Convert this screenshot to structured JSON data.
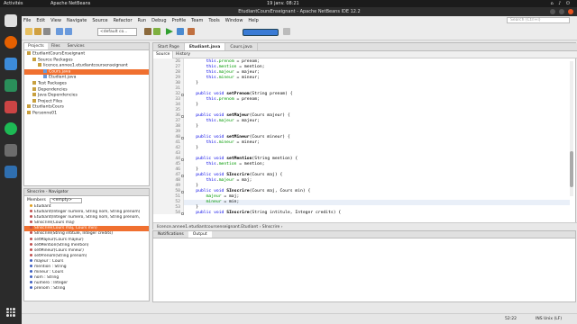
{
  "system": {
    "activities": "Activités",
    "app_name": "Apache NetBeans",
    "clock": "19 janv. 08:21"
  },
  "window": {
    "title": "EtudiantCoursEnseignant - Apache NetBeans IDE 12.2"
  },
  "menu": [
    "File",
    "Edit",
    "View",
    "Navigate",
    "Source",
    "Refactor",
    "Run",
    "Debug",
    "Profile",
    "Team",
    "Tools",
    "Window",
    "Help"
  ],
  "search_placeholder": "Search (Ctrl+I)",
  "toolbar": {
    "config": "<default co...",
    "icons": [
      "new-file-icon",
      "open-project-icon",
      "save-icon",
      "undo-icon",
      "redo-icon",
      "build-icon",
      "run-icon",
      "debug-icon",
      "profile-icon"
    ]
  },
  "projects": {
    "tabs": [
      "Projects",
      "Files",
      "Services"
    ],
    "nodes": [
      {
        "label": "EtudiantCoursEnseignant",
        "depth": 0
      },
      {
        "label": "Source Packages",
        "depth": 1
      },
      {
        "label": "licence.annee1.etudiantcoursenseignant",
        "depth": 2
      },
      {
        "label": "Cours.java",
        "depth": 3,
        "selected": true
      },
      {
        "label": "Etudiant.java",
        "depth": 3
      },
      {
        "label": "Test Packages",
        "depth": 1
      },
      {
        "label": "Dependencies",
        "depth": 1
      },
      {
        "label": "Java Dependencies",
        "depth": 1
      },
      {
        "label": "Project Files",
        "depth": 1
      },
      {
        "label": "EtudiantsCours",
        "depth": 0
      },
      {
        "label": "Personne01",
        "depth": 0
      }
    ]
  },
  "navigator": {
    "title": "SInscrire - Navigator",
    "filter_label": "Members",
    "filter_value": "<empty>",
    "items": [
      {
        "label": "Etudiant",
        "kind": "class"
      },
      {
        "label": "Etudiant(Integer numero, String nom, String prenom)",
        "kind": "m"
      },
      {
        "label": "Etudiant(Integer numero, String nom, String prenom,",
        "kind": "m"
      },
      {
        "label": "SInscrire(Cours maj)",
        "kind": "m"
      },
      {
        "label": "SInscrire(Cours maj, Cours min)",
        "kind": "m",
        "selected": true
      },
      {
        "label": "SInscrire(String intitule, Integer credits)",
        "kind": "m"
      },
      {
        "label": "setMajeur(Cours majeur)",
        "kind": "m"
      },
      {
        "label": "setMention(String mention)",
        "kind": "m"
      },
      {
        "label": "setMineur(Cours mineur)",
        "kind": "m"
      },
      {
        "label": "setPrenom(String prenom)",
        "kind": "m"
      },
      {
        "label": "majeur : Cours",
        "kind": "f"
      },
      {
        "label": "mention : String",
        "kind": "f"
      },
      {
        "label": "mineur : Cours",
        "kind": "f"
      },
      {
        "label": "nom : String",
        "kind": "f"
      },
      {
        "label": "numero : Integer",
        "kind": "f"
      },
      {
        "label": "prenom : String",
        "kind": "f"
      }
    ]
  },
  "editor": {
    "tabs": [
      "Start Page",
      "Etudiant.java",
      "Cours.java"
    ],
    "active_tab": 1,
    "source_tabs": [
      "Source",
      "History"
    ],
    "lines": [
      {
        "n": "26",
        "text": "        this.prenom = prenom;"
      },
      {
        "n": "27",
        "text": "        this.mention = mention;"
      },
      {
        "n": "28",
        "text": "        this.majeur = majeur;"
      },
      {
        "n": "29",
        "text": "        this.mineur = mineur;"
      },
      {
        "n": "30",
        "text": "    }"
      },
      {
        "n": "31",
        "text": ""
      },
      {
        "n": "32",
        "text": "    public void setPrenom(String prenom) {",
        "fold": true
      },
      {
        "n": "33",
        "text": "        this.prenom = prenom;"
      },
      {
        "n": "34",
        "text": "    }"
      },
      {
        "n": "35",
        "text": ""
      },
      {
        "n": "36",
        "text": "    public void setMajeur(Cours majeur) {",
        "fold": true
      },
      {
        "n": "37",
        "text": "        this.majeur = majeur;"
      },
      {
        "n": "38",
        "text": "    }"
      },
      {
        "n": "39",
        "text": ""
      },
      {
        "n": "40",
        "text": "    public void setMineur(Cours mineur) {",
        "fold": true
      },
      {
        "n": "41",
        "text": "        this.mineur = mineur;"
      },
      {
        "n": "42",
        "text": "    }"
      },
      {
        "n": "43",
        "text": ""
      },
      {
        "n": "44",
        "text": "    public void setMention(String mention) {",
        "fold": true
      },
      {
        "n": "45",
        "text": "        this.mention = mention;"
      },
      {
        "n": "46",
        "text": "    }"
      },
      {
        "n": "47",
        "text": "    public void SInscrire(Cours maj) {",
        "fold": true
      },
      {
        "n": "48",
        "text": "        this.majeur = maj;"
      },
      {
        "n": "49",
        "text": "    }"
      },
      {
        "n": "50",
        "text": "    public void SInscrire(Cours maj, Cours min) {",
        "fold": true
      },
      {
        "n": "51",
        "text": "        majeur = maj;"
      },
      {
        "n": "52",
        "text": "        mineur = min;",
        "current": true
      },
      {
        "n": "53",
        "text": "    }"
      },
      {
        "n": "54",
        "text": "    public void SInscrire(String intitule, Integer credits) {",
        "fold": true
      }
    ],
    "breadcrumb": "licence.annee1.etudiantcoursenseignant.Etudiant  ›  SInscrire  ›"
  },
  "output": {
    "tabs": [
      "Notifications",
      "Output"
    ],
    "active_tab": 1
  },
  "status": {
    "position": "52:22",
    "mode": "INS  Unix (LF)"
  }
}
